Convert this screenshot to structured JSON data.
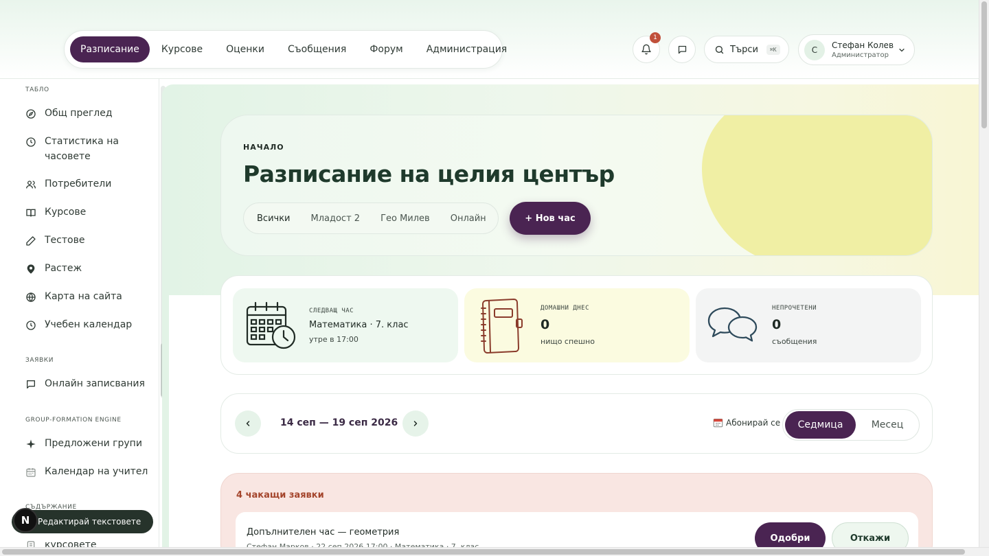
{
  "nav": {
    "items": [
      {
        "label": "Разписание",
        "active": true
      },
      {
        "label": "Курсове"
      },
      {
        "label": "Оценки"
      },
      {
        "label": "Съобщения"
      },
      {
        "label": "Форум"
      },
      {
        "label": "Администрация"
      }
    ]
  },
  "header": {
    "notifications_count": "1",
    "search_label": "Търси",
    "search_shortcut": "⌘K",
    "user": {
      "initial": "С",
      "name": "Стефан Колев",
      "role": "Администратор"
    }
  },
  "sidebar": {
    "sections": [
      {
        "title": "ТАБЛО",
        "items": [
          {
            "label": "Общ преглед",
            "icon": "compass-icon"
          },
          {
            "label": "Статистика на часовете",
            "icon": "clock-icon"
          },
          {
            "label": "Потребители",
            "icon": "users-icon"
          },
          {
            "label": "Курсове",
            "icon": "book-icon"
          },
          {
            "label": "Тестове",
            "icon": "pencil-icon"
          },
          {
            "label": "Растеж",
            "icon": "location-pin-icon"
          },
          {
            "label": "Карта на сайта",
            "icon": "globe-icon"
          },
          {
            "label": "Учебен календар",
            "icon": "clock-icon"
          }
        ]
      },
      {
        "title": "ЗАЯВКИ",
        "items": [
          {
            "label": "Онлайн записвания",
            "icon": "chat-icon"
          }
        ]
      },
      {
        "title": "GROUP-FORMATION ENGINE",
        "items": [
          {
            "label": "Предложени групи",
            "icon": "sparkle-icon"
          },
          {
            "label": "Календар на учител",
            "icon": "calendar-icon"
          }
        ]
      },
      {
        "title": "СЪДЪРЖАНИЕ",
        "items": [
          {
            "label": "курсовете",
            "icon": "document-icon"
          }
        ]
      }
    ]
  },
  "hero": {
    "kicker": "НАЧАЛО",
    "title": "Разписание на целия център",
    "filters": [
      "Всички",
      "Младост 2",
      "Гео Милев",
      "Онлайн"
    ],
    "new_button": "+ Нов час"
  },
  "stats": [
    {
      "label": "СЛЕДВАЩ ЧАС",
      "value": "Математика · 7. клас",
      "sub": "утре в 17:00",
      "icon": "calendar-clock-icon",
      "bg": "#eef8f0"
    },
    {
      "label": "ДОМАШНИ ДНЕС",
      "value": "0",
      "sub": "нищо спешно",
      "icon": "notebook-icon",
      "bg": "#fbfbe0"
    },
    {
      "label": "НЕПРОЧЕТЕНИ",
      "value": "0",
      "sub": "съобщения",
      "icon": "chat-bubbles-icon",
      "bg": "#f3f4f4"
    }
  ],
  "week": {
    "range": "14 сеп — 19 сеп 2026",
    "subscribe": "Абонирай се",
    "views": [
      "Седмица",
      "Месец"
    ],
    "active_view": "Седмица"
  },
  "requests": {
    "title": "4 чакащи заявки",
    "item": {
      "name": "Допълнителен час — геометрия",
      "meta": "Стефан Марков · 22 сеп 2026 17:00 · Математика · 7. клас",
      "approve": "Одобри",
      "reject": "Откажи"
    }
  },
  "floating": {
    "logo": "N",
    "label": "Редактирай текстовете"
  },
  "colors": {
    "accent": "#4a2452",
    "mint": "#e6f3e9",
    "request_bg": "#f9e6e2",
    "alert": "#a4452c"
  }
}
